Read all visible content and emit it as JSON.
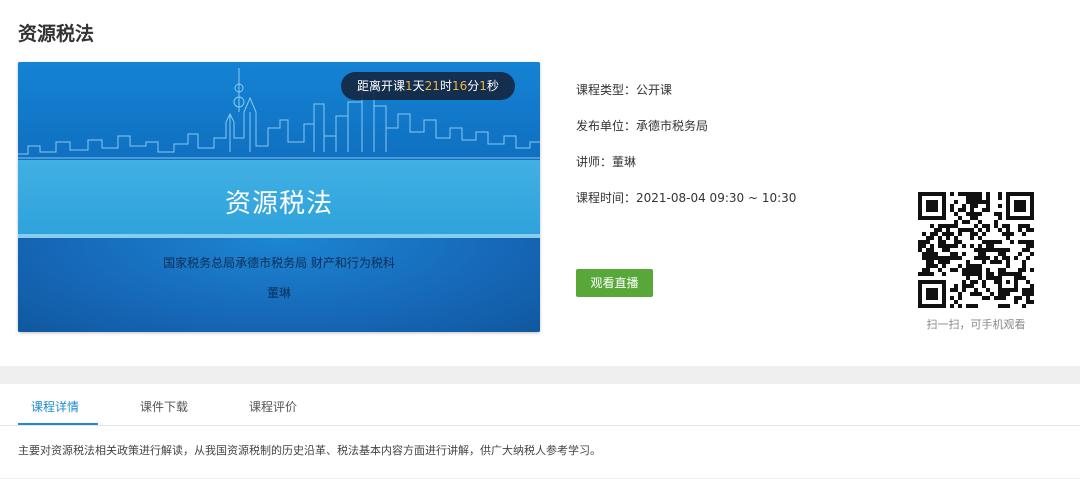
{
  "page": {
    "title": "资源税法"
  },
  "banner": {
    "title": "资源税法",
    "organization": "国家税务总局承德市税务局 财产和行为税科",
    "lecturer": "董琳",
    "countdown": {
      "prefix": "距离开课",
      "days": "1",
      "days_unit": "天",
      "hours": "21",
      "hours_unit": "时",
      "minutes": "16",
      "minutes_unit": "分",
      "seconds": "1",
      "seconds_unit": "秒"
    }
  },
  "course_info": {
    "type": "课程类型：公开课",
    "unit": "发布单位：承德市税务局",
    "lecturer": "讲师：董琳",
    "time": "课程时间：2021-08-04 09:30 ~ 10:30"
  },
  "actions": {
    "watch_live": "观看直播"
  },
  "qr": {
    "caption": "扫一扫，可手机观看"
  },
  "tabs": [
    {
      "label": "课程详情",
      "active": true
    },
    {
      "label": "课件下载",
      "active": false
    },
    {
      "label": "课程评价",
      "active": false
    }
  ],
  "description": "主要对资源税法相关政策进行解读，从我国资源税制的历史沿革、税法基本内容方面进行讲解，供广大纳税人参考学习。",
  "colors": {
    "accent_blue": "#1f8ad0",
    "watch_button_green": "#57a839",
    "countdown_highlight": "#f2b63c",
    "banner_blue": "#1a72c1"
  }
}
